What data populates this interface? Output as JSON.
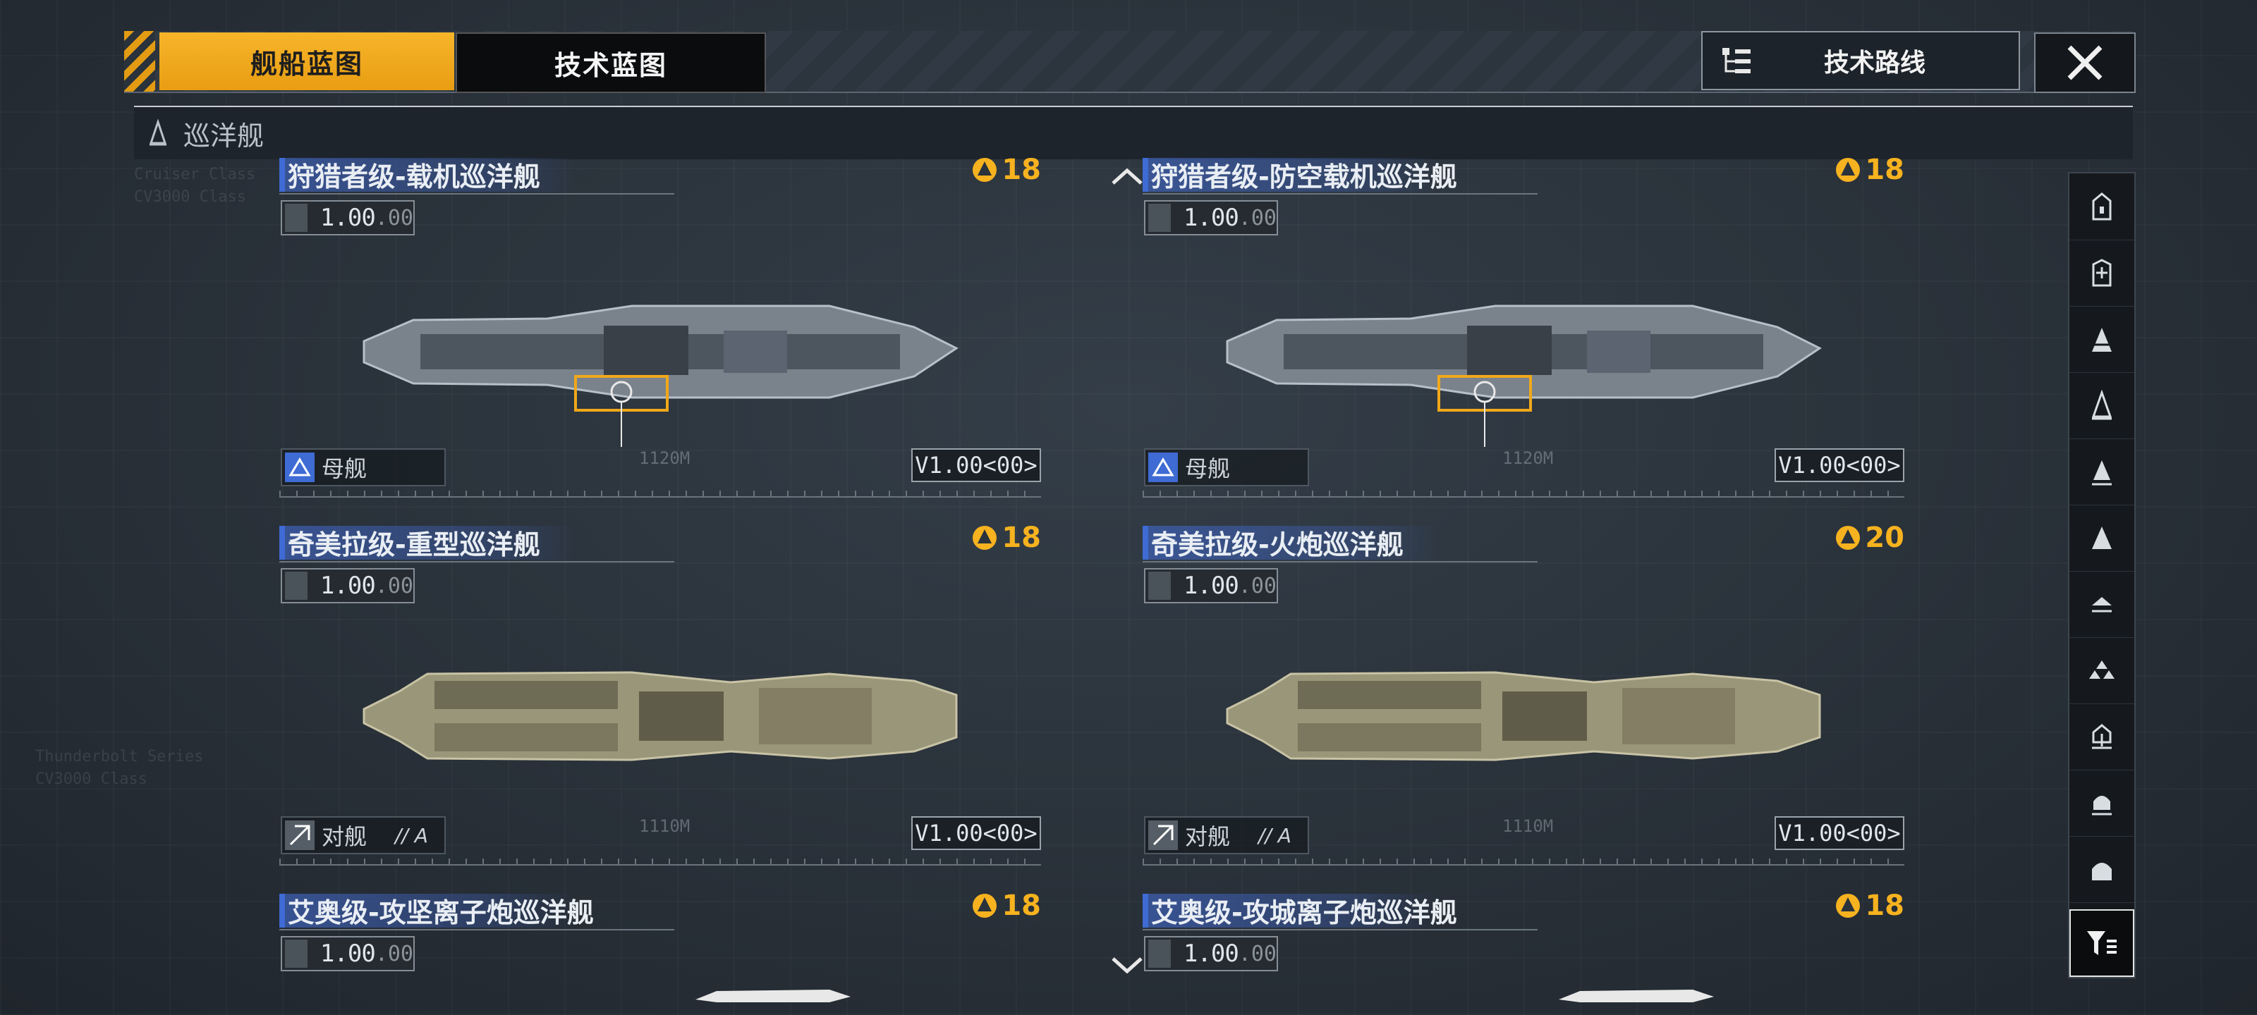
{
  "tabs": {
    "ship_blueprint": "舰船蓝图",
    "tech_blueprint": "技术蓝图"
  },
  "tech_route_label": "技术路线",
  "section_title": "巡洋舰",
  "colors": {
    "accent": "#f0a81a",
    "title_bar": "#3e6bd4",
    "cost": "#f6b21f"
  },
  "cards": [
    {
      "title": "狩猎者级-载机巡洋舰",
      "cost": "18",
      "rating": "1.00",
      "rating_dec": ".00",
      "type": "母舰",
      "type_suffix": "",
      "version": "V1.00<00>",
      "hull": "grey"
    },
    {
      "title": "狩猎者级-防空载机巡洋舰",
      "cost": "18",
      "rating": "1.00",
      "rating_dec": ".00",
      "type": "母舰",
      "type_suffix": "",
      "version": "V1.00<00>",
      "hull": "grey"
    },
    {
      "title": "奇美拉级-重型巡洋舰",
      "cost": "18",
      "rating": "1.00",
      "rating_dec": ".00",
      "type": "对舰",
      "type_suffix": "// A",
      "version": "V1.00<00>",
      "hull": "khaki"
    },
    {
      "title": "奇美拉级-火炮巡洋舰",
      "cost": "20",
      "rating": "1.00",
      "rating_dec": ".00",
      "type": "对舰",
      "type_suffix": "// A",
      "version": "V1.00<00>",
      "hull": "khaki"
    },
    {
      "title": "艾奥级-攻坚离子炮巡洋舰",
      "cost": "18",
      "rating": "1.00",
      "rating_dec": ".00",
      "type": "",
      "type_suffix": "",
      "version": "",
      "hull": "white"
    },
    {
      "title": "艾奥级-攻城离子炮巡洋舰",
      "cost": "18",
      "rating": "1.00",
      "rating_dec": ".00",
      "type": "",
      "type_suffix": "",
      "version": "",
      "hull": "white"
    }
  ],
  "rail_icons": [
    "class-1-icon",
    "class-2-icon",
    "class-3-icon",
    "class-4-icon",
    "class-5-icon",
    "class-6-icon",
    "class-7-icon",
    "class-8-icon",
    "class-9-icon",
    "class-10-icon",
    "class-11-icon"
  ],
  "filter_icon": "filter-icon"
}
